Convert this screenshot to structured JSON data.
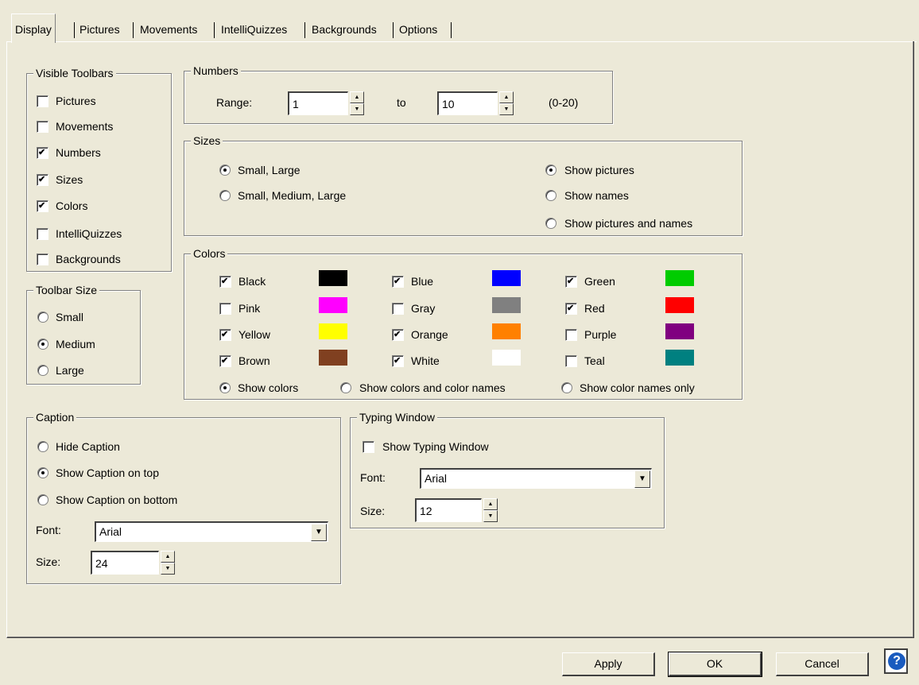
{
  "tabs": [
    "Display",
    "Pictures",
    "Movements",
    "IntelliQuizzes",
    "Backgrounds",
    "Options"
  ],
  "visible_toolbars": {
    "title": "Visible Toolbars",
    "items": [
      {
        "label": "Pictures",
        "checked": false
      },
      {
        "label": "Movements",
        "checked": false
      },
      {
        "label": "Numbers",
        "checked": true
      },
      {
        "label": "Sizes",
        "checked": true
      },
      {
        "label": "Colors",
        "checked": true
      },
      {
        "label": "IntelliQuizzes",
        "checked": false
      },
      {
        "label": "Backgrounds",
        "checked": false
      }
    ]
  },
  "toolbar_size": {
    "title": "Toolbar Size",
    "options": [
      "Small",
      "Medium",
      "Large"
    ],
    "selected": "Medium"
  },
  "numbers": {
    "title": "Numbers",
    "range_label": "Range:",
    "from": "1",
    "to_label": "to",
    "to": "10",
    "hint": "(0-20)"
  },
  "sizes": {
    "title": "Sizes",
    "size_options": [
      "Small, Large",
      "Small, Medium, Large"
    ],
    "size_selected": "Small, Large",
    "show_options": [
      "Show pictures",
      "Show names",
      "Show pictures and names"
    ],
    "show_selected": "Show pictures"
  },
  "colors": {
    "title": "Colors",
    "items": [
      {
        "label": "Black",
        "checked": true,
        "color": "#000000"
      },
      {
        "label": "Blue",
        "checked": true,
        "color": "#0000ff"
      },
      {
        "label": "Green",
        "checked": true,
        "color": "#00cc00"
      },
      {
        "label": "Pink",
        "checked": false,
        "color": "#ff00ff"
      },
      {
        "label": "Gray",
        "checked": false,
        "color": "#808080"
      },
      {
        "label": "Red",
        "checked": true,
        "color": "#ff0000"
      },
      {
        "label": "Yellow",
        "checked": true,
        "color": "#ffff00"
      },
      {
        "label": "Orange",
        "checked": true,
        "color": "#ff8000"
      },
      {
        "label": "Purple",
        "checked": false,
        "color": "#800080"
      },
      {
        "label": "Brown",
        "checked": true,
        "color": "#804020"
      },
      {
        "label": "White",
        "checked": true,
        "color": "#ffffff"
      },
      {
        "label": "Teal",
        "checked": false,
        "color": "#008080"
      }
    ],
    "mode_options": [
      "Show colors",
      "Show colors and color names",
      "Show color names only"
    ],
    "mode_selected": "Show colors"
  },
  "caption": {
    "title": "Caption",
    "options": [
      "Hide Caption",
      "Show Caption on top",
      "Show Caption on bottom"
    ],
    "selected": "Show Caption on top",
    "font_label": "Font:",
    "font": "Arial",
    "size_label": "Size:",
    "size": "24"
  },
  "typing_window": {
    "title": "Typing Window",
    "show_label": "Show Typing Window",
    "show_checked": false,
    "font_label": "Font:",
    "font": "Arial",
    "size_label": "Size:",
    "size": "12"
  },
  "buttons": {
    "apply": "Apply",
    "ok": "OK",
    "cancel": "Cancel",
    "help_icon": "question-mark-icon"
  }
}
